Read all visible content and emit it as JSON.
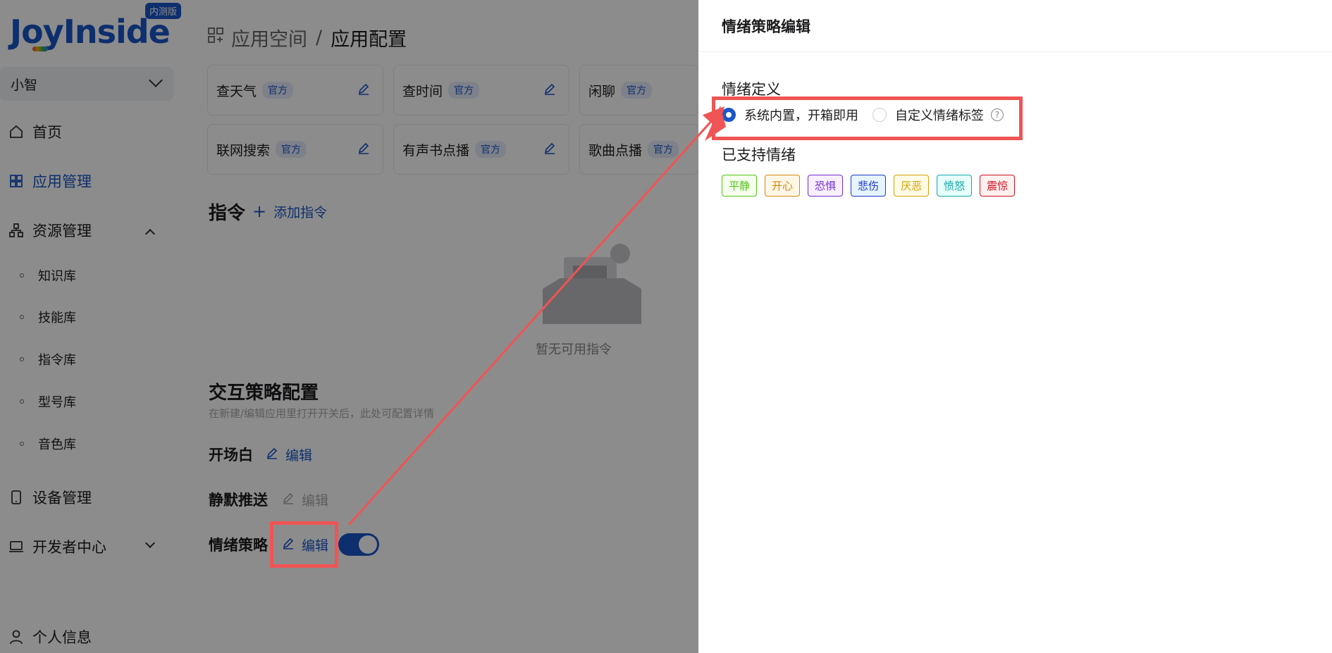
{
  "sidebar": {
    "logo": "JoyInside",
    "badge": "内测版",
    "space": "小智",
    "nav": {
      "home": "首页",
      "app_manage": "应用管理",
      "resource_manage": "资源管理",
      "subs": [
        "知识库",
        "技能库",
        "指令库",
        "型号库",
        "音色库"
      ],
      "device_manage": "设备管理",
      "dev_center": "开发者中心",
      "profile": "个人信息"
    }
  },
  "main": {
    "breadcrumb": {
      "parent": "应用空间",
      "separator": "/",
      "current": "应用配置"
    },
    "official_tag": "官方",
    "skills": [
      "查天气",
      "查时间",
      "闲聊",
      "联网搜索",
      "有声书点播",
      "歌曲点播"
    ],
    "commands_title": "指令",
    "add_command": "添加指令",
    "empty_text": "暂无可用指令",
    "interaction_title": "交互策略配置",
    "interaction_hint": "在新建/编辑应用里打开开关后，此处可配置详情",
    "rows": {
      "opening": "开场白",
      "silent_push": "静默推送",
      "emotion": "情绪策略"
    },
    "edit_label": "编辑",
    "emotion_enabled": true
  },
  "drawer": {
    "title": "情绪策略编辑",
    "definition_label": "情绪定义",
    "option_builtin": "系统内置，开箱即用",
    "option_custom": "自定义情绪标签",
    "supported_label": "已支持情绪",
    "emotions": [
      {
        "label": "平静",
        "color": "#52c41a",
        "bg": "#f6ffed"
      },
      {
        "label": "开心",
        "color": "#d48806",
        "bg": "#fff7e6"
      },
      {
        "label": "恐惧",
        "color": "#722ed1",
        "bg": "#f9f0ff"
      },
      {
        "label": "悲伤",
        "color": "#1d39c4",
        "bg": "#e6f4ff"
      },
      {
        "label": "厌恶",
        "color": "#d4a106",
        "bg": "#fffbe6"
      },
      {
        "label": "愤怒",
        "color": "#13a8a8",
        "bg": "#e6fffb"
      },
      {
        "label": "震惊",
        "color": "#cf1322",
        "bg": "#fff1f0"
      }
    ]
  },
  "colors": {
    "accent": "#1a56c8",
    "annotation": "#f05454"
  }
}
